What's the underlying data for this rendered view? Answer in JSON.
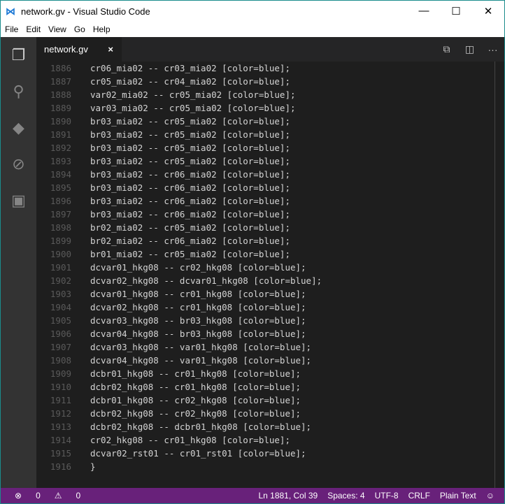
{
  "window": {
    "title": "network.gv - Visual Studio Code",
    "minimize": "—",
    "maximize": "☐",
    "close": "✕"
  },
  "menu": [
    "File",
    "Edit",
    "View",
    "Go",
    "Help"
  ],
  "tab": {
    "label": "network.gv",
    "close": "×"
  },
  "lines": [
    {
      "n": "1886",
      "t": "cr06_mia02 -- cr03_mia02 [color=blue];"
    },
    {
      "n": "1887",
      "t": "cr05_mia02 -- cr04_mia02 [color=blue];"
    },
    {
      "n": "1888",
      "t": "var02_mia02 -- cr05_mia02 [color=blue];"
    },
    {
      "n": "1889",
      "t": "var03_mia02 -- cr05_mia02 [color=blue];"
    },
    {
      "n": "1890",
      "t": "br03_mia02 -- cr05_mia02 [color=blue];"
    },
    {
      "n": "1891",
      "t": "br03_mia02 -- cr05_mia02 [color=blue];"
    },
    {
      "n": "1892",
      "t": "br03_mia02 -- cr05_mia02 [color=blue];"
    },
    {
      "n": "1893",
      "t": "br03_mia02 -- cr05_mia02 [color=blue];"
    },
    {
      "n": "1894",
      "t": "br03_mia02 -- cr06_mia02 [color=blue];"
    },
    {
      "n": "1895",
      "t": "br03_mia02 -- cr06_mia02 [color=blue];"
    },
    {
      "n": "1896",
      "t": "br03_mia02 -- cr06_mia02 [color=blue];"
    },
    {
      "n": "1897",
      "t": "br03_mia02 -- cr06_mia02 [color=blue];"
    },
    {
      "n": "1898",
      "t": "br02_mia02 -- cr05_mia02 [color=blue];"
    },
    {
      "n": "1899",
      "t": "br02_mia02 -- cr06_mia02 [color=blue];"
    },
    {
      "n": "1900",
      "t": "br01_mia02 -- cr05_mia02 [color=blue];"
    },
    {
      "n": "1901",
      "t": "dcvar01_hkg08 -- cr02_hkg08 [color=blue];"
    },
    {
      "n": "1902",
      "t": "dcvar02_hkg08 -- dcvar01_hkg08 [color=blue];"
    },
    {
      "n": "1903",
      "t": "dcvar01_hkg08 -- cr01_hkg08 [color=blue];"
    },
    {
      "n": "1904",
      "t": "dcvar02_hkg08 -- cr01_hkg08 [color=blue];"
    },
    {
      "n": "1905",
      "t": "dcvar03_hkg08 -- br03_hkg08 [color=blue];"
    },
    {
      "n": "1906",
      "t": "dcvar04_hkg08 -- br03_hkg08 [color=blue];"
    },
    {
      "n": "1907",
      "t": "dcvar03_hkg08 -- var01_hkg08 [color=blue];"
    },
    {
      "n": "1908",
      "t": "dcvar04_hkg08 -- var01_hkg08 [color=blue];"
    },
    {
      "n": "1909",
      "t": "dcbr01_hkg08 -- cr01_hkg08 [color=blue];"
    },
    {
      "n": "1910",
      "t": "dcbr02_hkg08 -- cr01_hkg08 [color=blue];"
    },
    {
      "n": "1911",
      "t": "dcbr01_hkg08 -- cr02_hkg08 [color=blue];"
    },
    {
      "n": "1912",
      "t": "dcbr02_hkg08 -- cr02_hkg08 [color=blue];"
    },
    {
      "n": "1913",
      "t": "dcbr02_hkg08 -- dcbr01_hkg08 [color=blue];"
    },
    {
      "n": "1914",
      "t": "cr02_hkg08 -- cr01_hkg08 [color=blue];"
    },
    {
      "n": "1915",
      "t": "dcvar02_rst01 -- cr01_rst01 [color=blue];"
    },
    {
      "n": "1916",
      "t": "}"
    }
  ],
  "status": {
    "errors": "0",
    "warnings": "0",
    "position": "Ln 1881, Col 39",
    "spaces": "Spaces: 4",
    "encoding": "UTF-8",
    "eol": "CRLF",
    "language": "Plain Text"
  },
  "colors": {
    "status": "#68217a",
    "editor": "#1e1e1e"
  }
}
